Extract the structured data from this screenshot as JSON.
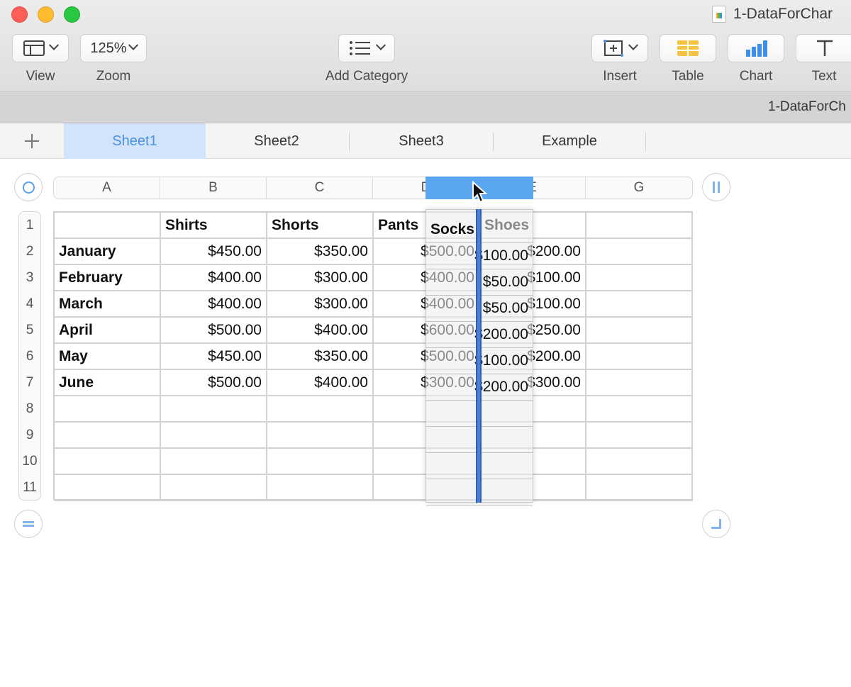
{
  "window": {
    "title": "1-DataForChar",
    "document_title": "1-DataForCh"
  },
  "toolbar": {
    "view_label": "View",
    "zoom_value": "125%",
    "zoom_label": "Zoom",
    "add_category_label": "Add Category",
    "insert_label": "Insert",
    "table_label": "Table",
    "chart_label": "Chart",
    "text_label": "Text"
  },
  "tabs": [
    {
      "label": "Sheet1",
      "active": true
    },
    {
      "label": "Sheet2",
      "active": false
    },
    {
      "label": "Sheet3",
      "active": false
    },
    {
      "label": "Example",
      "active": false
    }
  ],
  "columns": [
    "A",
    "B",
    "C",
    "D",
    "E",
    "F",
    "G"
  ],
  "rows": [
    "1",
    "2",
    "3",
    "4",
    "5",
    "6",
    "7",
    "8",
    "9",
    "10",
    "11"
  ],
  "table": {
    "headers": [
      "",
      "Shirts",
      "Shorts",
      "Pants",
      "Shoes",
      ""
    ],
    "data": [
      [
        "January",
        "$450.00",
        "$350.00",
        "$500.00",
        "$200.00"
      ],
      [
        "February",
        "$400.00",
        "$300.00",
        "$400.00",
        "$100.00"
      ],
      [
        "March",
        "$400.00",
        "$300.00",
        "$400.00",
        "$100.00"
      ],
      [
        "April",
        "$500.00",
        "$400.00",
        "$600.00",
        "$250.00"
      ],
      [
        "May",
        "$450.00",
        "$350.00",
        "$500.00",
        "$200.00"
      ],
      [
        "June",
        "$500.00",
        "$400.00",
        "$300.00",
        "$300.00"
      ]
    ]
  },
  "dragged_column": {
    "header": "Socks",
    "values": [
      "$100.00",
      "$50.00",
      "$50.00",
      "$200.00",
      "$100.00",
      "$200.00"
    ]
  },
  "colors": {
    "accent": "#4a90e2",
    "selection": "#5aa7f0",
    "insert_bar": "#4a7fd8"
  }
}
